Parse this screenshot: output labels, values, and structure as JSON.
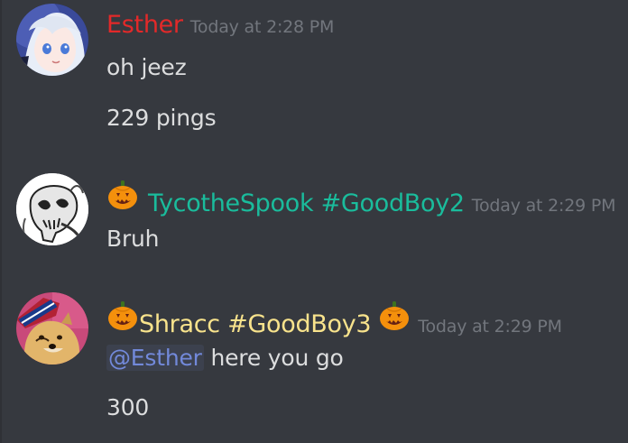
{
  "messages": [
    {
      "username": "Esther",
      "username_color": "#e32929",
      "timestamp": "Today at 2:28 PM",
      "lines": [
        "oh jeez",
        "229 pings"
      ]
    },
    {
      "prefix_icon": "jack-o-lantern-icon",
      "username": "TycotheSpook #GoodBoy2",
      "username_color": "#1abc9c",
      "timestamp": "Today at 2:29 PM",
      "lines": [
        "Bruh"
      ]
    },
    {
      "prefix_icon": "jack-o-lantern-icon",
      "suffix_icon": "jack-o-lantern-icon",
      "username": "Shracc #GoodBoy3",
      "username_color": "#f8e38c",
      "timestamp": "Today at 2:29 PM",
      "mention": "@Esther",
      "mention_color": "#7289da",
      "lines": [
        "here you go",
        "300"
      ]
    }
  ]
}
